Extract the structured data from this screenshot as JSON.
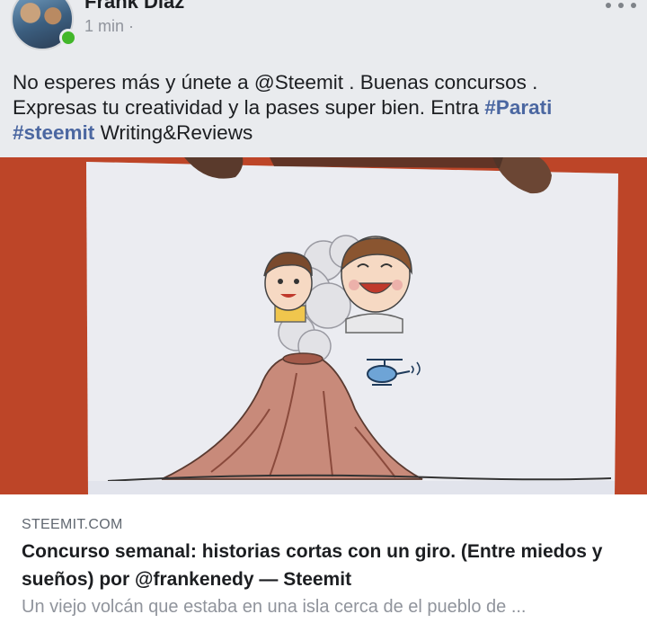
{
  "post": {
    "author_name": "Frank Díaz",
    "timestamp": "1 min",
    "separator": "·",
    "text_line1": "No esperes más y únete a @Steemit . Buenas concursos .",
    "text_line2": "Expresas tu creatividad y la pases super bien. Entra",
    "hashtag1": "#Parati",
    "hashtag2": "#steemit",
    "text_end": "Writing&Reviews"
  },
  "link": {
    "domain": "STEEMIT.COM",
    "title": "Concurso semanal: historias cortas con un giro. (Entre miedos y sueños) por @frankenedy — Steemit",
    "description": "Un viejo volcán que estaba en una isla cerca de el pueblo de ...",
    "image_alt": "Drawing of a volcano with two children's faces in the smoke and a helicopter"
  },
  "colors": {
    "header_bg": "#e9ebee",
    "hashtag": "#4b67a1",
    "online": "#42b72a",
    "muted": "#90949c"
  }
}
